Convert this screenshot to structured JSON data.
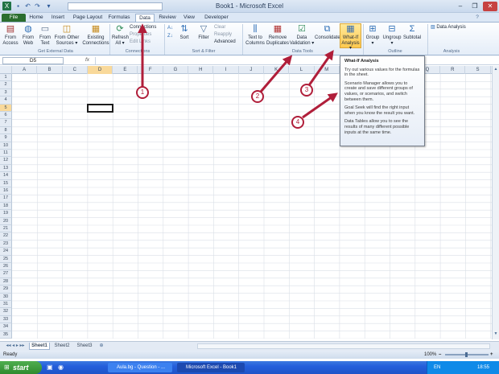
{
  "window": {
    "title": "Book1 - Microsoft Excel",
    "minimize": "–",
    "restore": "❐",
    "close": "✕"
  },
  "tabs": [
    {
      "label": "File"
    },
    {
      "label": "Home"
    },
    {
      "label": "Insert"
    },
    {
      "label": "Page Layout"
    },
    {
      "label": "Formulas"
    },
    {
      "label": "Data"
    },
    {
      "label": "Review"
    },
    {
      "label": "View"
    },
    {
      "label": "Developer"
    }
  ],
  "ribbon": {
    "get_external": {
      "from_access": "From\nAccess",
      "from_web": "From\nWeb",
      "from_text": "From\nText",
      "from_other": "From Other\nSources ▾",
      "existing": "Existing\nConnections",
      "group": "Get External Data"
    },
    "connections": {
      "refresh": "Refresh\nAll ▾",
      "connections": "Connections",
      "properties": "Properties",
      "edit_links": "Edit Links",
      "group": "Connections"
    },
    "sort_filter": {
      "sort": "Sort",
      "filter": "Filter",
      "clear": "Clear",
      "reapply": "Reapply",
      "advanced": "Advanced",
      "group": "Sort & Filter"
    },
    "data_tools": {
      "text_to_columns": "Text to\nColumns",
      "remove_duplicates": "Remove\nDuplicates",
      "data_validation": "Data\nValidation ▾",
      "consolidate": "Consolidate",
      "what_if": "What-If\nAnalysis ▾",
      "group": "Data Tools"
    },
    "outline": {
      "group_btn": "Group\n▾",
      "ungroup": "Ungroup\n▾",
      "subtotal": "Subtotal",
      "group": "Outline"
    },
    "analysis": {
      "data_analysis": "Data Analysis",
      "group": "Analysis"
    }
  },
  "formula_bar": {
    "name_box": "D5",
    "fx": "fx",
    "value": ""
  },
  "tooltip": {
    "title": "What-If Analysis",
    "p1": "Try out various values for the formulas in the sheet.",
    "p2": "Scenario Manager allows you to create and save different groups of values, or scenarios, and switch between them.",
    "p3": "Goal Seek will find the right input when you know the result you want.",
    "p4": "Data Tables allow you to see the results of many different possible inputs at the same time."
  },
  "columns": [
    "A",
    "B",
    "C",
    "D",
    "E",
    "F",
    "G",
    "H",
    "I",
    "J",
    "K",
    "L",
    "M",
    "N",
    "O",
    "P",
    "Q",
    "R",
    "S"
  ],
  "rows": [
    "1",
    "2",
    "3",
    "4",
    "5",
    "6",
    "7",
    "8",
    "9",
    "10",
    "11",
    "12",
    "13",
    "14",
    "15",
    "16",
    "17",
    "18",
    "19",
    "20",
    "21",
    "22",
    "23",
    "24",
    "25",
    "26",
    "27",
    "28",
    "29",
    "30",
    "31",
    "32",
    "33",
    "34",
    "35"
  ],
  "selected_cell": "D5",
  "sheets": [
    {
      "label": "Sheet1"
    },
    {
      "label": "Sheet2"
    },
    {
      "label": "Sheet3"
    }
  ],
  "status": {
    "ready": "Ready",
    "zoom": "100%",
    "zoom_minus": "–",
    "zoom_plus": "+"
  },
  "callouts": [
    "1",
    "2",
    "3",
    "4"
  ],
  "taskbar": {
    "start": "start",
    "tasks": [
      {
        "label": "Aula.bg - Question - ..."
      },
      {
        "label": "Microsoft Excel - Book1"
      }
    ],
    "lang": "EN",
    "clock": "18:55"
  },
  "colors": {
    "accent": "#2b6e2f",
    "callout": "#b01e3a",
    "whatif_highlight": "#ffc94e"
  }
}
